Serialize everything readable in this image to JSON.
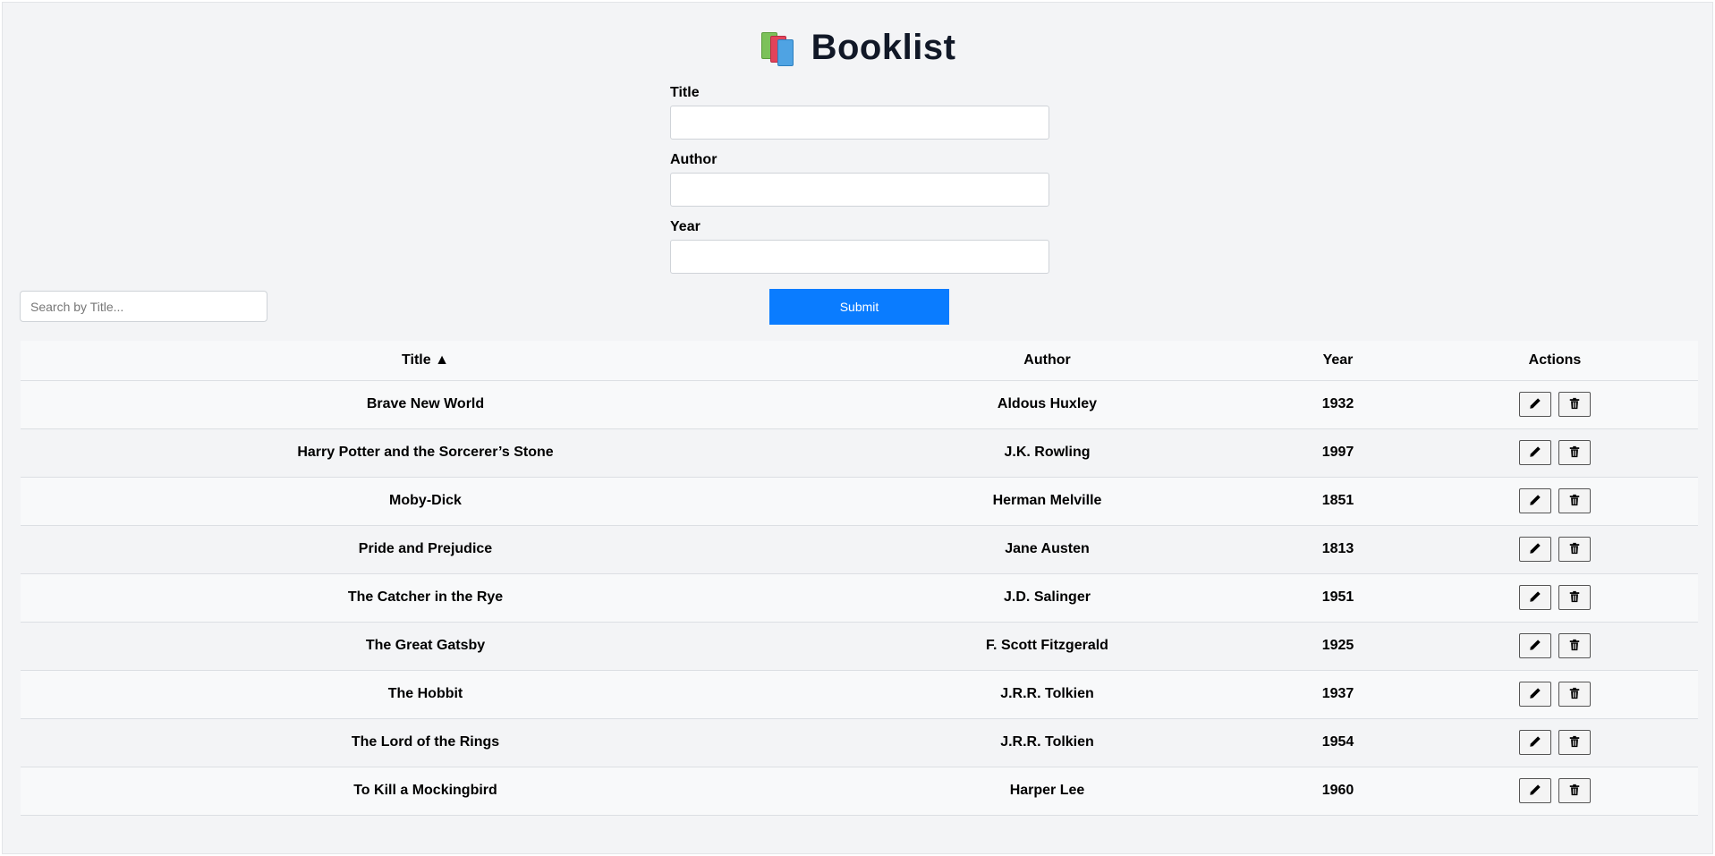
{
  "header": {
    "title": "Booklist",
    "logo_icon": "books-icon"
  },
  "form": {
    "title_label": "Title",
    "title_value": "",
    "author_label": "Author",
    "author_value": "",
    "year_label": "Year",
    "year_value": "",
    "submit_label": "Submit"
  },
  "search": {
    "placeholder": "Search by Title...",
    "value": ""
  },
  "table": {
    "headers": {
      "title": "Title ▲",
      "author": "Author",
      "year": "Year",
      "actions": "Actions"
    },
    "rows": [
      {
        "title": "Brave New World",
        "author": "Aldous Huxley",
        "year": "1932"
      },
      {
        "title": "Harry Potter and the Sorcerer’s Stone",
        "author": "J.K. Rowling",
        "year": "1997"
      },
      {
        "title": "Moby-Dick",
        "author": "Herman Melville",
        "year": "1851"
      },
      {
        "title": "Pride and Prejudice",
        "author": "Jane Austen",
        "year": "1813"
      },
      {
        "title": "The Catcher in the Rye",
        "author": "J.D. Salinger",
        "year": "1951"
      },
      {
        "title": "The Great Gatsby",
        "author": "F. Scott Fitzgerald",
        "year": "1925"
      },
      {
        "title": "The Hobbit",
        "author": "J.R.R. Tolkien",
        "year": "1937"
      },
      {
        "title": "The Lord of the Rings",
        "author": "J.R.R. Tolkien",
        "year": "1954"
      },
      {
        "title": "To Kill a Mockingbird",
        "author": "Harper Lee",
        "year": "1960"
      }
    ],
    "row_actions": [
      "edit-icon",
      "trash-icon"
    ]
  },
  "colors": {
    "background": "#f3f4f6",
    "submit_button": "#0a7cff",
    "title_text": "#111827"
  }
}
